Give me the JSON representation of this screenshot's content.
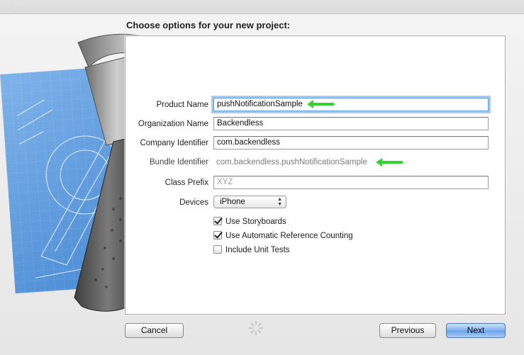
{
  "window": {
    "title": "Choose options for your new project:"
  },
  "form": {
    "product_name": {
      "label": "Product Name",
      "value": "pushNotificationSample"
    },
    "organization_name": {
      "label": "Organization Name",
      "value": "Backendless"
    },
    "company_identifier": {
      "label": "Company Identifier",
      "value": "com.backendless"
    },
    "bundle_identifier": {
      "label": "Bundle Identifier",
      "value": "com.backendless.pushNotificationSample"
    },
    "class_prefix": {
      "label": "Class Prefix",
      "placeholder": "XYZ"
    },
    "devices": {
      "label": "Devices",
      "selected": "iPhone"
    },
    "checkboxes": [
      {
        "label": "Use Storyboards",
        "checked": true
      },
      {
        "label": "Use Automatic Reference Counting",
        "checked": true
      },
      {
        "label": "Include Unit Tests",
        "checked": false
      }
    ]
  },
  "buttons": {
    "cancel": "Cancel",
    "previous": "Previous",
    "next": "Next"
  },
  "colors": {
    "accent": "#6aa3ea",
    "annotation_arrow": "#2fd42f",
    "blueprint": "#4f8fd6"
  },
  "icons": {
    "hammer": "hammer-icon",
    "blueprint": "blueprint-artwork",
    "arrow": "green-arrow-annotation",
    "spinner": "spinner-icon"
  }
}
